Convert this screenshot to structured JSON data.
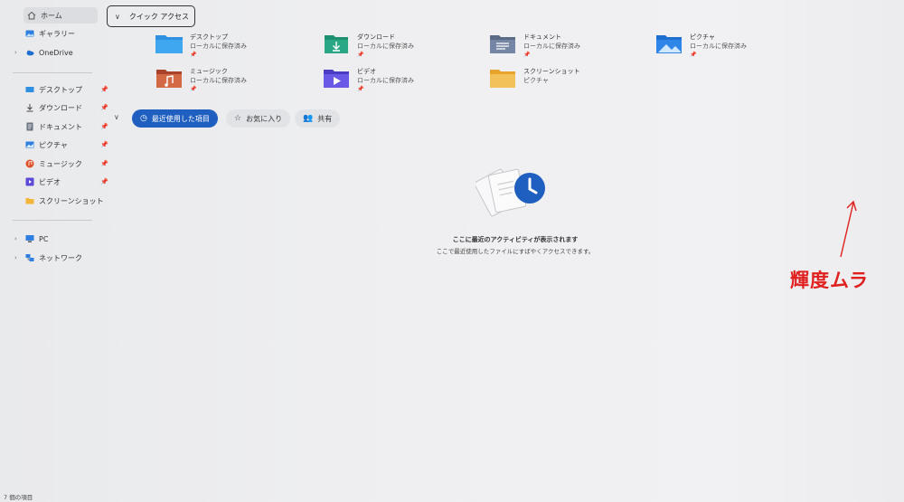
{
  "sidebar": {
    "top_items": [
      {
        "label": "ホーム",
        "icon": "home-icon",
        "active": true
      },
      {
        "label": "ギャラリー",
        "icon": "gallery-icon"
      },
      {
        "label": "OneDrive",
        "icon": "onedrive-icon"
      }
    ],
    "pinned_items": [
      {
        "label": "デスクトップ",
        "icon": "desktop-icon",
        "pinned": true
      },
      {
        "label": "ダウンロード",
        "icon": "download-icon",
        "pinned": true
      },
      {
        "label": "ドキュメント",
        "icon": "document-icon",
        "pinned": true
      },
      {
        "label": "ピクチャ",
        "icon": "pictures-icon",
        "pinned": true
      },
      {
        "label": "ミュージック",
        "icon": "music-icon",
        "pinned": true
      },
      {
        "label": "ビデオ",
        "icon": "video-icon",
        "pinned": true
      },
      {
        "label": "スクリーンショット",
        "icon": "folder-icon",
        "pinned": false
      }
    ],
    "bottom_items": [
      {
        "label": "PC",
        "icon": "pc-icon"
      },
      {
        "label": "ネットワーク",
        "icon": "network-icon"
      }
    ]
  },
  "quick_access": {
    "header_label": "クイック アクセス",
    "tiles": [
      {
        "name": "デスクトップ",
        "sub": "ローカルに保存済み",
        "pinned": true,
        "icon": "desktop-folder-icon"
      },
      {
        "name": "ダウンロード",
        "sub": "ローカルに保存済み",
        "pinned": true,
        "icon": "download-folder-icon"
      },
      {
        "name": "ドキュメント",
        "sub": "ローカルに保存済み",
        "pinned": true,
        "icon": "document-folder-icon"
      },
      {
        "name": "ピクチャ",
        "sub": "ローカルに保存済み",
        "pinned": true,
        "icon": "pictures-folder-icon"
      },
      {
        "name": "ミュージック",
        "sub": "ローカルに保存済み",
        "pinned": true,
        "icon": "music-folder-icon"
      },
      {
        "name": "ビデオ",
        "sub": "ローカルに保存済み",
        "pinned": true,
        "icon": "video-folder-icon"
      },
      {
        "name": "スクリーンショット",
        "sub": "ピクチャ",
        "pinned": false,
        "icon": "screenshot-folder-icon"
      }
    ]
  },
  "recent": {
    "tabs": [
      {
        "label": "最近使用した項目",
        "active": true
      },
      {
        "label": "お気に入り",
        "active": false
      },
      {
        "label": "共有",
        "active": false
      }
    ],
    "empty_title": "ここに最近のアクティビティが表示されます",
    "empty_desc": "ここで最近使用したファイルにすばやくアクセスできます。"
  },
  "annotation": {
    "text": "輝度ムラ",
    "color": "#e0201e"
  },
  "status_bar": {
    "item_count": "7 個の項目"
  },
  "colors": {
    "accent": "#1f5fbf",
    "background": "#ecedef"
  }
}
